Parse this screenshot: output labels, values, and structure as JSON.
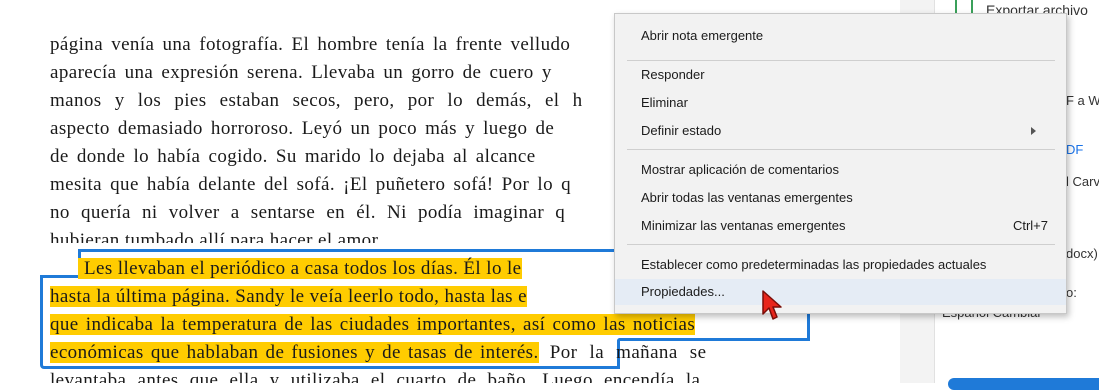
{
  "document": {
    "lines": [
      "página venía una fotografía. El hombre tenía la frente velludo",
      "aparecía una expresión serena. Llevaba un gorro de cuero y",
      "manos y los pies estaban secos, pero, por lo demás, el h",
      "aspecto demasiado horroroso. Leyó un poco más y luego de",
      "de donde lo había cogido. Su marido lo dejaba al alcance",
      "mesita que había delante del sofá. ¡El puñetero sofá! Por lo q",
      "no quería ni volver a sentarse en él. Ni podía imaginar q",
      "hubieran tumbado allí para hacer el amor."
    ],
    "highlighted_lines": [
      "Les llevaban el periódico a casa todos los días. Él lo le",
      "hasta la última página. Sandy le veía leerlo todo, hasta las e",
      "que indicaba la temperatura de las ciudades importantes, así como las noticias",
      "económicas que hablaban de fusiones y de tasas de interés."
    ],
    "after_highlight": "Por la mañana se",
    "last_line": "levantaba antes que ella y utilizaba el cuarto de baño. Luego encendía la"
  },
  "panel": {
    "export_label": "Exportar archivo",
    "frag_fa_w": "F a W",
    "frag_df": "DF",
    "frag_carv": "l Carv",
    "frag_docx": "docx)",
    "frag_o": "o:",
    "language_label": "Español  Cambiar"
  },
  "context_menu": {
    "items": [
      {
        "label": "Abrir nota emergente"
      },
      {
        "label": "Responder"
      },
      {
        "label": "Eliminar"
      },
      {
        "label": "Definir estado"
      },
      {
        "label": "Mostrar aplicación de comentarios"
      },
      {
        "label": "Abrir todas las ventanas emergentes"
      },
      {
        "label": "Minimizar las ventanas emergentes",
        "shortcut": "Ctrl+7"
      },
      {
        "label": "Establecer como predeterminadas las propiedades actuales"
      },
      {
        "label": "Propiedades..."
      }
    ]
  },
  "colors": {
    "highlight": "#ffcc00",
    "selection_border": "#1f7ad8",
    "menu_bg": "#f2f2f2",
    "cursor": "#e8251b"
  }
}
